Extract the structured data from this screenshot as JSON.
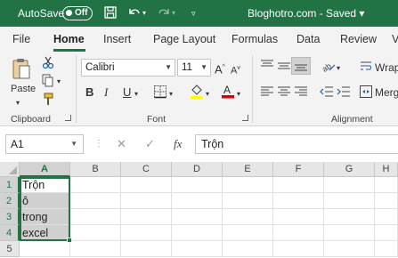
{
  "titlebar": {
    "autosave_label": "AutoSave",
    "autosave_state": "Off",
    "title": "Bloghotro.com - Saved ▾",
    "icons": [
      "save-icon",
      "undo-icon",
      "redo-icon",
      "customize-qat-icon"
    ],
    "accent": "#217346"
  },
  "menu": {
    "tabs": [
      "File",
      "Home",
      "Insert",
      "Page Layout",
      "Formulas",
      "Data",
      "Review",
      "V"
    ],
    "active": "Home"
  },
  "ribbon": {
    "clipboard": {
      "label": "Clipboard",
      "paste_label": "Paste"
    },
    "font": {
      "label": "Font",
      "font_name": "Calibri",
      "font_size": "11",
      "bold": "B",
      "italic": "I",
      "underline": "U",
      "grow": "A",
      "shrink": "A",
      "fill_color": "#ffff00",
      "font_color": "#e00000"
    },
    "alignment": {
      "label": "Alignment",
      "wrap": "Wrap",
      "merge": "Merg"
    }
  },
  "formula_bar": {
    "name_box": "A1",
    "fx": "fx",
    "content": "Trộn",
    "cancel_icon": "✕",
    "enter_icon": "✓"
  },
  "grid": {
    "columns": [
      "A",
      "B",
      "C",
      "D",
      "E",
      "F",
      "G",
      "H"
    ],
    "selected_column": "A",
    "rows": [
      "1",
      "2",
      "3",
      "4",
      "5"
    ],
    "cells": {
      "A1": "Trộn",
      "A2": "ô",
      "A3": "trong",
      "A4": "excel"
    }
  }
}
